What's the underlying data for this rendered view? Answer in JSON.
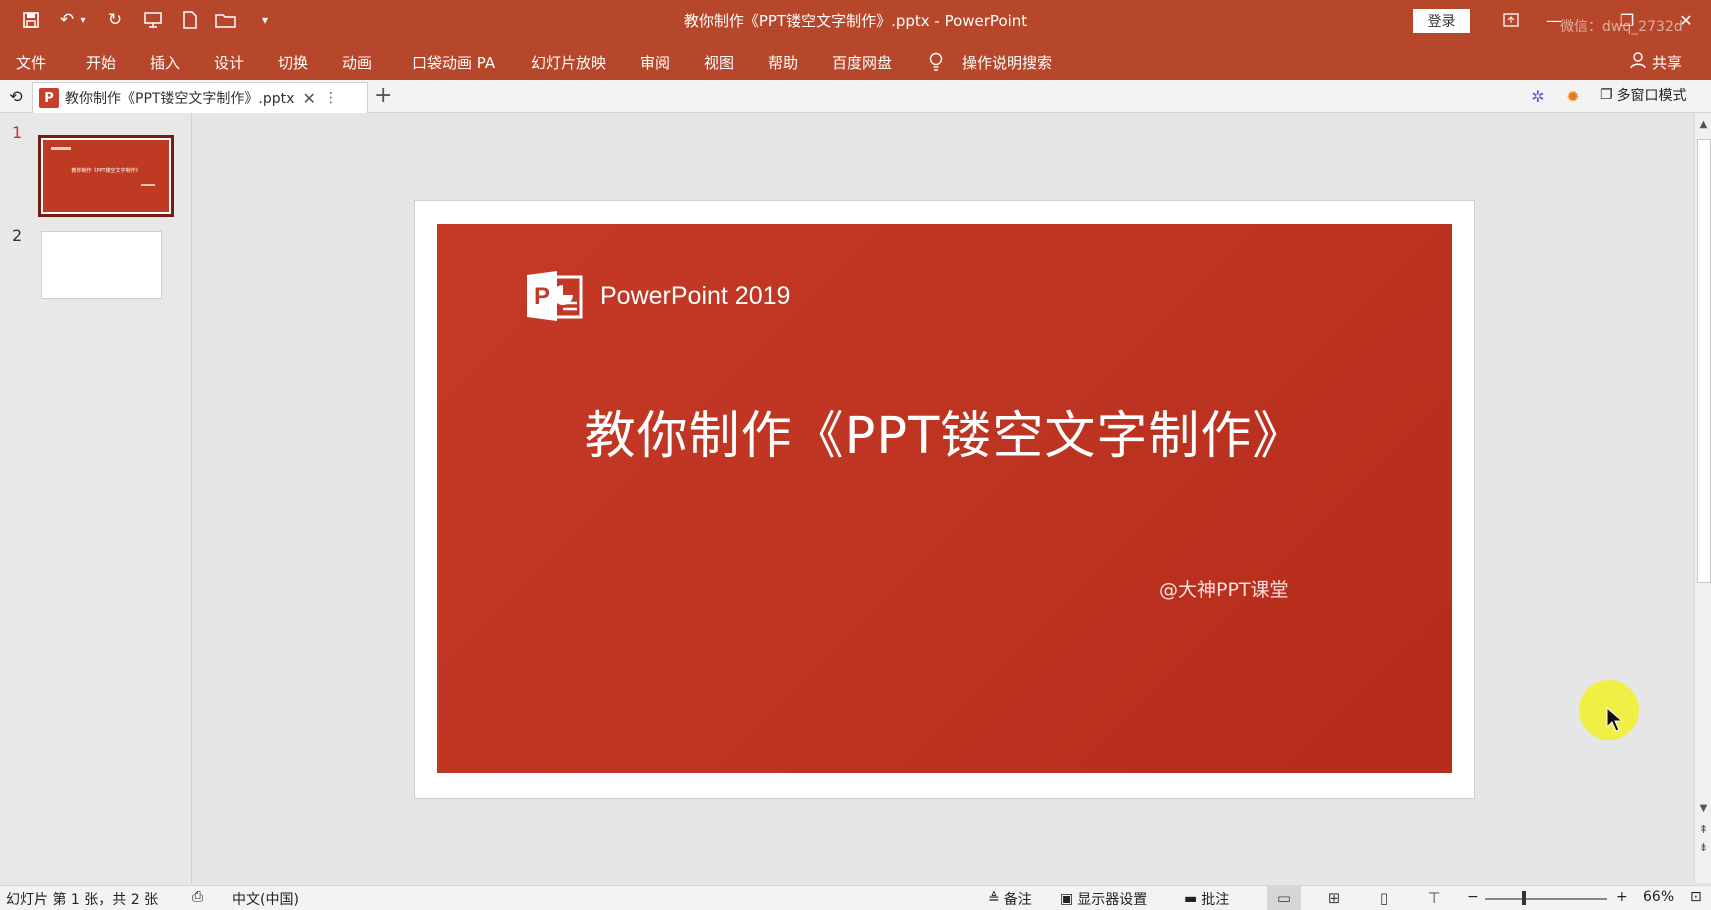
{
  "window": {
    "title": "教你制作《PPT镂空文字制作》.pptx  -  PowerPoint",
    "login_label": "登录",
    "watermark": "微信：dwq_2732d"
  },
  "ribbon": {
    "tabs": [
      "文件",
      "开始",
      "插入",
      "设计",
      "切换",
      "动画",
      "口袋动画 PA",
      "幻灯片放映",
      "审阅",
      "视图",
      "帮助",
      "百度网盘"
    ],
    "search_label": "操作说明搜索",
    "share_label": "共享"
  },
  "tabstrip": {
    "doc_tab_label": "教你制作《PPT镂空文字制作》.pptx",
    "multiwindow_label": "多窗口模式"
  },
  "thumbnails": {
    "slide_numbers": [
      "1",
      "2"
    ],
    "slide1_mini_title": "教你制作《PPT镂空文字制作》"
  },
  "slide": {
    "brand": "PowerPoint 2019",
    "logo_letter": "P",
    "title": "教你制作《PPT镂空文字制作》",
    "subtitle": "@大神PPT课堂"
  },
  "statusbar": {
    "slide_info": "幻灯片 第 1 张，共 2 张",
    "language": "中文(中国)",
    "notes_label": "备注",
    "display_settings_label": "显示器设置",
    "comments_label": "批注",
    "zoom": "66%"
  },
  "colors": {
    "accent": "#b7472a",
    "slide_bg": "#be3422"
  }
}
